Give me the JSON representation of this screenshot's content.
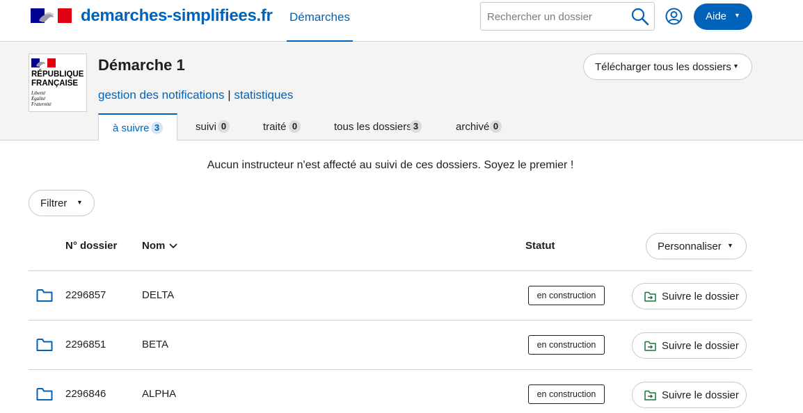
{
  "brand": {
    "site_name": "demarches-simplifiees.fr",
    "nav_label": "Démarches"
  },
  "search": {
    "placeholder": "Rechercher un dossier",
    "value": ""
  },
  "help": {
    "label": "Aide"
  },
  "logo": {
    "line1": "RÉPUBLIQUE",
    "line2": "FRANÇAISE",
    "motto1": "Liberté",
    "motto2": "Égalité",
    "motto3": "Fraternité"
  },
  "procedure": {
    "title": "Démarche 1",
    "link_notifications": "gestion des notifications",
    "link_separator": "|",
    "link_stats": "statistiques",
    "download_label": "Télécharger tous les dossiers"
  },
  "tabs": [
    {
      "label": "à suivre",
      "count": "3"
    },
    {
      "label": "suivi",
      "count": "0"
    },
    {
      "label": "traité",
      "count": "0"
    },
    {
      "label": "tous les dossiers",
      "count": "3"
    },
    {
      "label": "archivé",
      "count": "0"
    }
  ],
  "notice": "Aucun instructeur n'est affecté au suivi de ces dossiers. Soyez le premier !",
  "filter_label": "Filtrer",
  "table": {
    "col_number": "N° dossier",
    "col_name": "Nom",
    "col_status": "Statut",
    "customize_label": "Personnaliser",
    "rows": [
      {
        "number": "2296857",
        "name": "DELTA",
        "status": "en construction",
        "action": "Suivre le dossier"
      },
      {
        "number": "2296851",
        "name": "BETA",
        "status": "en construction",
        "action": "Suivre le dossier"
      },
      {
        "number": "2296846",
        "name": "ALPHA",
        "status": "en construction",
        "action": "Suivre le dossier"
      }
    ]
  },
  "colors": {
    "primary": "#0062b8",
    "marianne_red": "#e1000f",
    "marianne_blue": "#000091",
    "follow_green": "#18753c"
  }
}
